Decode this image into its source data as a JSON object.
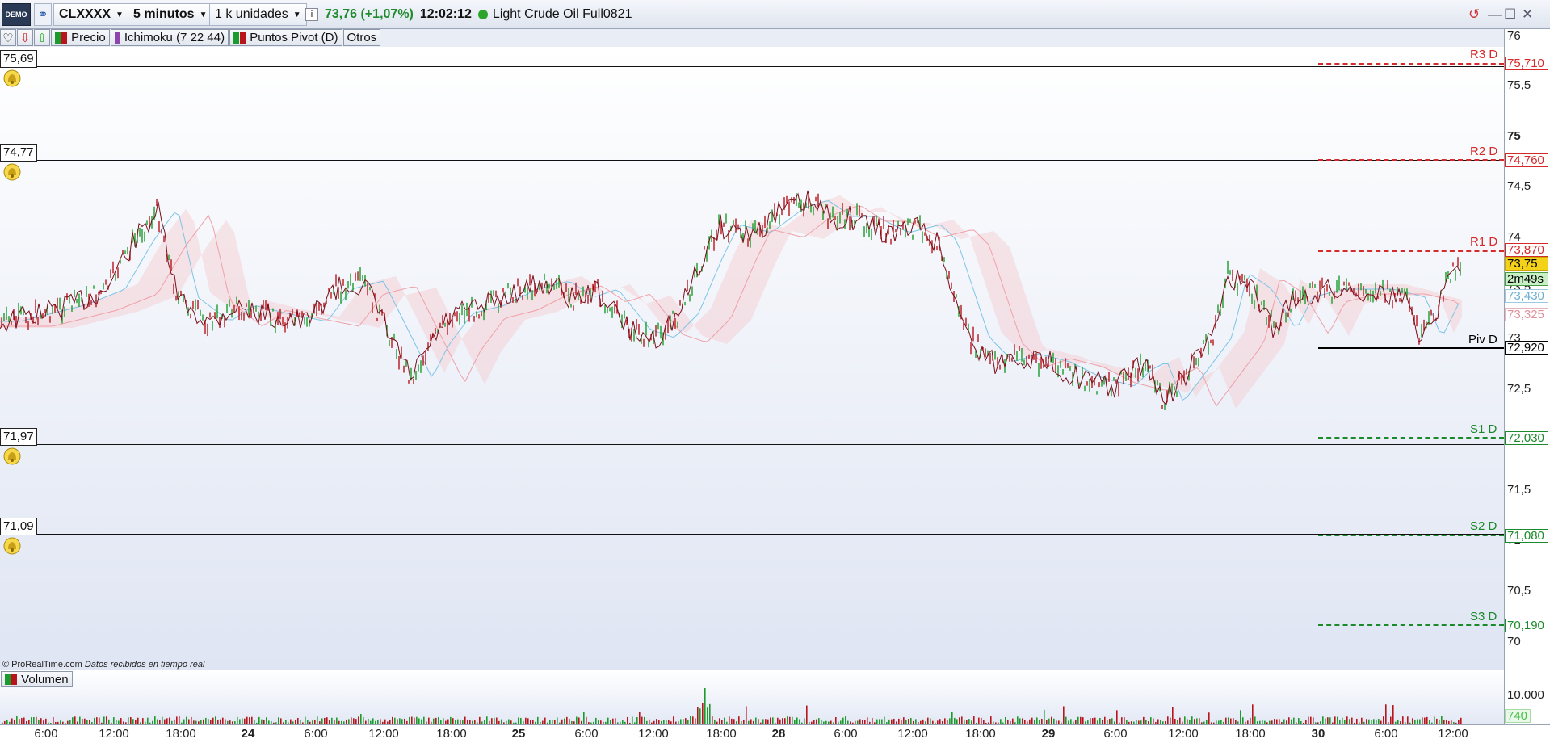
{
  "toolbar": {
    "logo": "DEMO",
    "ticker": "CLXXXX",
    "timeframe": "5 minutos",
    "units": "1 k unidades",
    "last_price": "73,76",
    "change": "(+1,07%)",
    "time": "12:02:12",
    "instrument": "Light Crude Oil Full0821"
  },
  "legend": {
    "price": "Precio",
    "ichimoku": "Ichimoku (7 22 44)",
    "pivots": "Puntos Pivot (D)",
    "others": "Otros"
  },
  "alerts": [
    "75,69",
    "74,77",
    "71,97",
    "71,09"
  ],
  "y_axis": [
    "76",
    "75,5",
    "75",
    "74,5",
    "74",
    "73,5",
    "73",
    "72,5",
    "72",
    "71,5",
    "71",
    "70,5",
    "70"
  ],
  "pivot_levels": [
    {
      "name": "R3 D",
      "value": "75,710",
      "color": "#d42a2a"
    },
    {
      "name": "R2 D",
      "value": "74,760",
      "color": "#d42a2a"
    },
    {
      "name": "R1 D",
      "value": "73,870",
      "color": "#d42a2a"
    },
    {
      "name": "Piv D",
      "value": "72,920",
      "color": "#000000"
    },
    {
      "name": "S1 D",
      "value": "72,030",
      "color": "#1a8a2a"
    },
    {
      "name": "S2 D",
      "value": "71,080",
      "color": "#1a8a2a"
    },
    {
      "name": "S3 D",
      "value": "70,190",
      "color": "#1a8a2a"
    }
  ],
  "price_tags": {
    "last": "73,75",
    "countdown": "2m49s",
    "cloud_a": "73,430",
    "cloud_b": "73,325"
  },
  "credits": {
    "site": "© ProRealTime.com",
    "note": "Datos recibidos en tiempo real"
  },
  "volume": {
    "label": "Volumen",
    "axis": "10.000",
    "last": "740"
  },
  "x_axis": [
    "6:00",
    "12:00",
    "18:00",
    "24",
    "6:00",
    "12:00",
    "18:00",
    "25",
    "6:00",
    "12:00",
    "18:00",
    "28",
    "6:00",
    "12:00",
    "18:00",
    "29",
    "6:00",
    "12:00",
    "18:00",
    "30",
    "6:00",
    "12:00"
  ],
  "colors": {
    "up": "#1b9b2b",
    "down": "#b8141c",
    "close_line": "#7a0f1a",
    "cloud_red": "#f3c9cf",
    "cloud_blue": "#cfe8f5",
    "resistance": "#d42a2a",
    "support": "#1a8a2a"
  }
}
